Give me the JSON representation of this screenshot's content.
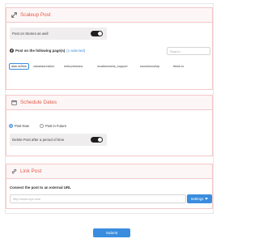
{
  "scaleup": {
    "title": "Scaleup Post",
    "stories_toggle_label": "Post on Stories as well",
    "pages_label": "Post on the following page(s)",
    "pages_selected": "(1 selected)",
    "search_placeholder": "Search",
    "pages": [
      "alan.w2fwe",
      "canadacreation",
      "enterprisesea",
      "localbusiness_support",
      "soundcloudvip",
      "tiktok.ro"
    ],
    "selected_page": "alan.w2fwe"
  },
  "schedule": {
    "title": "Schedule Dates",
    "option_now": "Post Now",
    "option_future": "Post in Future",
    "selected": "Post Now",
    "delete_label": "Delete Post after a period of time"
  },
  "link": {
    "title": "Link Post",
    "connect_label": "Connect the post to an external URL",
    "url_placeholder": "http://www.xyz.com",
    "settings_label": "Settings"
  },
  "submit_label": "Submit",
  "colors": {
    "accent": "#3a8dde",
    "panel_title": "#e05c4b",
    "panel_bg": "#fdf3f3"
  }
}
